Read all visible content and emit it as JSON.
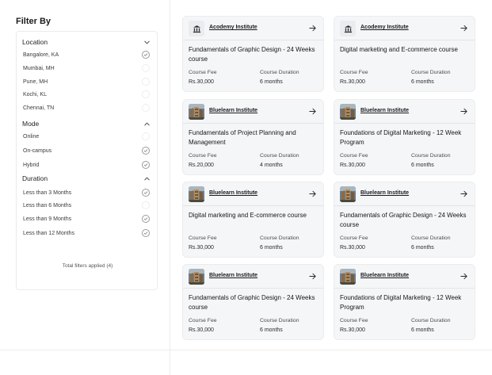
{
  "filters": {
    "title": "Filter By",
    "location": {
      "label": "Location",
      "options": [
        {
          "label": "Bangalore, KA",
          "checked": true
        },
        {
          "label": "Mumbai, MH",
          "checked": false
        },
        {
          "label": "Pune, MH",
          "checked": false
        },
        {
          "label": "Kochi, KL",
          "checked": false
        },
        {
          "label": "Chennai, TN",
          "checked": false
        }
      ]
    },
    "mode": {
      "label": "Mode",
      "options": [
        {
          "label": "Online",
          "checked": false
        },
        {
          "label": "On-campus",
          "checked": true
        },
        {
          "label": "Hybrid",
          "checked": true
        }
      ]
    },
    "duration": {
      "label": "Duration",
      "options": [
        {
          "label": "Less than 3 Months",
          "checked": true
        },
        {
          "label": "Less than 6 Months",
          "checked": false
        },
        {
          "label": "Less than 9 Months",
          "checked": true
        },
        {
          "label": "Less than 12 Months",
          "checked": true
        }
      ]
    },
    "total": "Total filters applied (4)"
  },
  "labels": {
    "fee": "Course Fee",
    "duration": "Course Duration"
  },
  "cards": [
    {
      "institute": "Acodemy Institute",
      "logo": "bank-icon",
      "course": "Fundamentals of Graphic Design -  24 Weeks course",
      "fee": "Rs.30,000",
      "duration": "6 months"
    },
    {
      "institute": "Acodemy Institute",
      "logo": "bank-icon",
      "course": "Digital marketing and E-commerce course",
      "fee": "Rs.30,000",
      "duration": "6 months"
    },
    {
      "institute": "Bluelearn Institute",
      "logo": "building-photo",
      "course": "Fundamentals of Project Planning and Management",
      "fee": "Rs.20,000",
      "duration": "4 months"
    },
    {
      "institute": "Bluelearn Institute",
      "logo": "building-photo",
      "course": "Foundations of Digital Marketing - 12 Week Program",
      "fee": "Rs.30,000",
      "duration": "6 months"
    },
    {
      "institute": "Bluelearn Institute",
      "logo": "building-photo",
      "course": "Digital marketing and E-commerce course",
      "fee": "Rs.30,000",
      "duration": "6 months"
    },
    {
      "institute": "Bluelearn Institute",
      "logo": "building-photo",
      "course": "Fundamentals of Graphic Design -  24 Weeks course",
      "fee": "Rs.30,000",
      "duration": "6 months"
    },
    {
      "institute": "Bluelearn Institute",
      "logo": "building-photo",
      "course": "Fundamentals of Graphic Design -  24 Weeks course",
      "fee": "Rs.30,000",
      "duration": "6 months"
    },
    {
      "institute": "Bluelearn Institute",
      "logo": "building-photo",
      "course": "Foundations of Digital Marketing - 12 Week Program",
      "fee": "Rs.30,000",
      "duration": "6 months"
    }
  ]
}
